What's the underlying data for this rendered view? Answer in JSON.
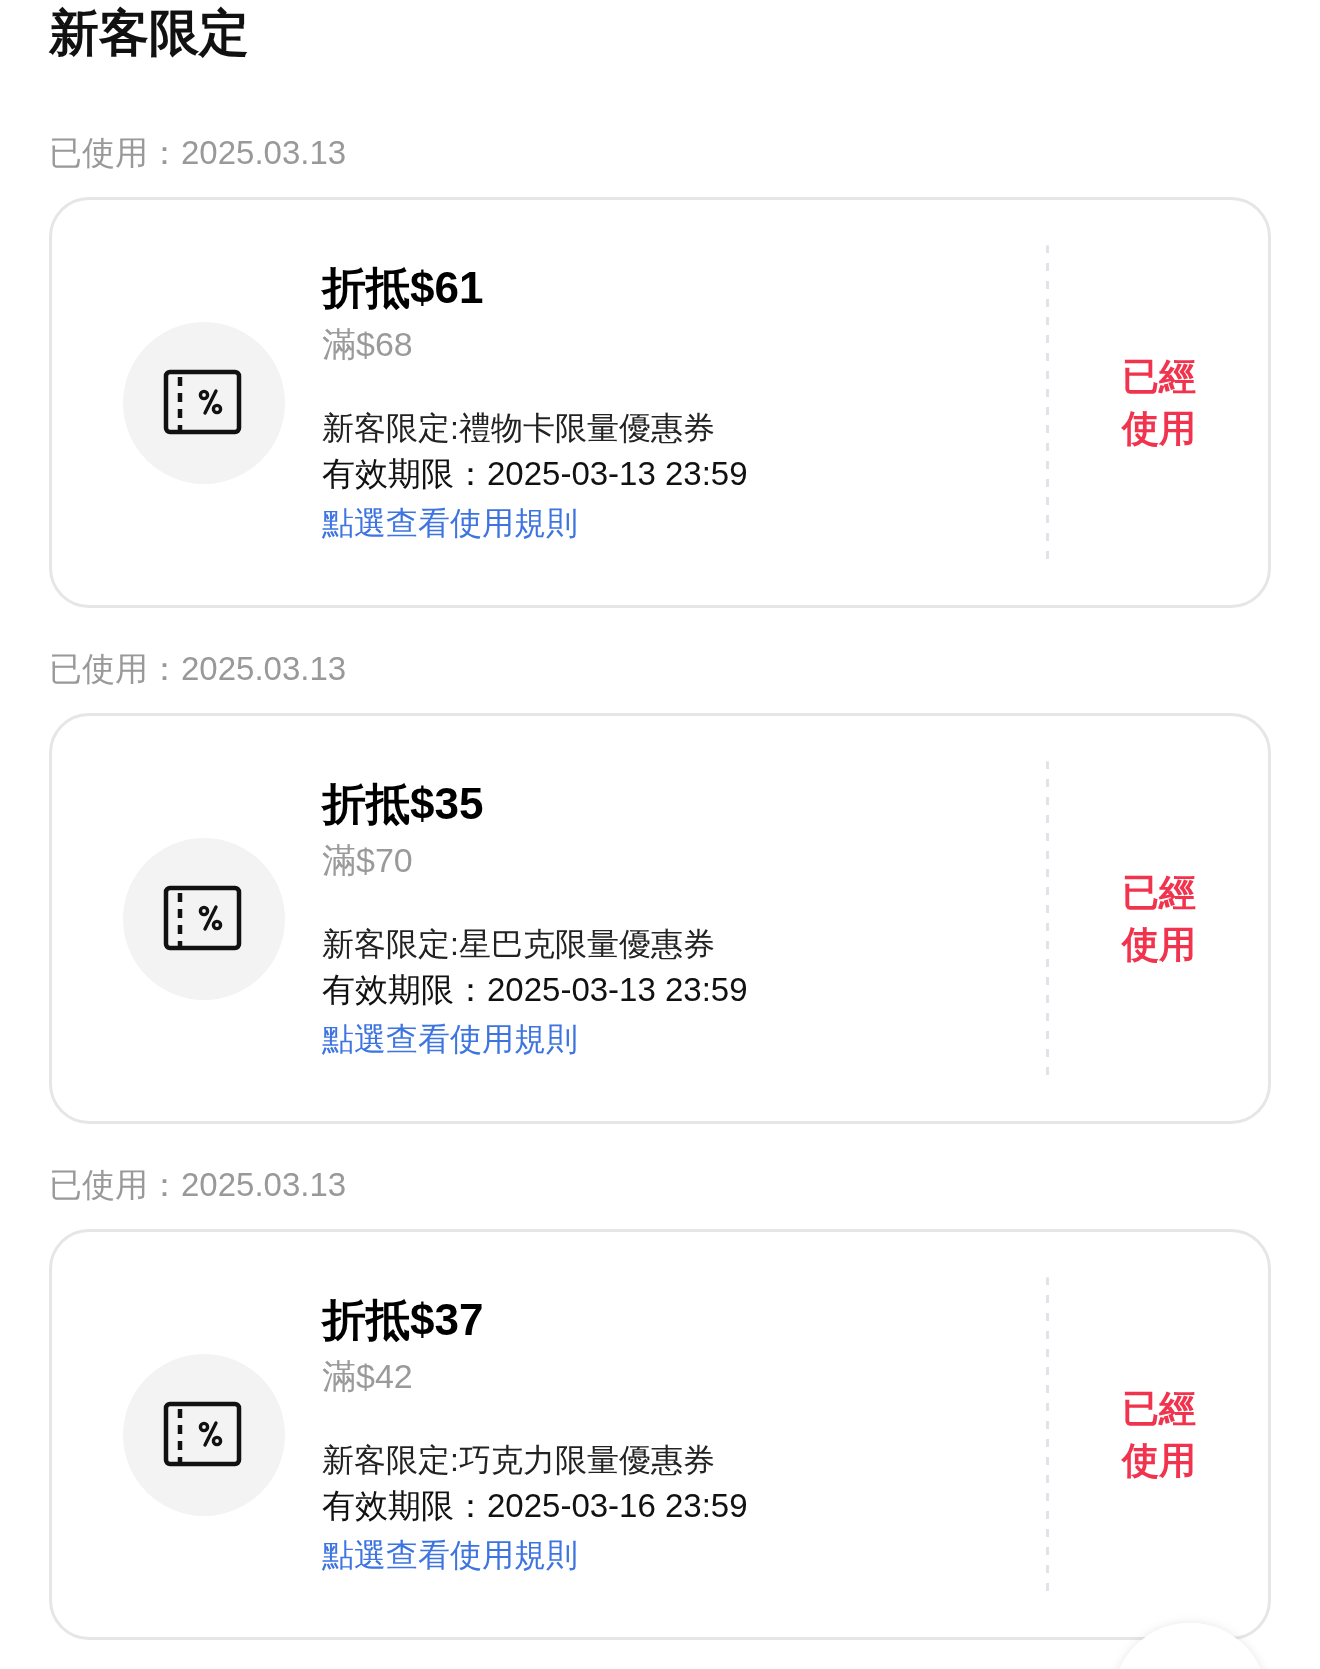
{
  "title": "新客限定",
  "coupons": [
    {
      "used_date": "已使用：2025.03.13",
      "discount": "折抵$61",
      "minimum": "滿$68",
      "name": "新客限定:禮物卡限量優惠券",
      "validity": "有效期限：2025-03-13 23:59",
      "rules_link": "點選查看使用規則",
      "status": "已經使用"
    },
    {
      "used_date": "已使用：2025.03.13",
      "discount": "折抵$35",
      "minimum": "滿$70",
      "name": "新客限定:星巴克限量優惠券",
      "validity": "有效期限：2025-03-13 23:59",
      "rules_link": "點選查看使用規則",
      "status": "已經使用"
    },
    {
      "used_date": "已使用：2025.03.13",
      "discount": "折抵$37",
      "minimum": "滿$42",
      "name": "新客限定:巧克力限量優惠券",
      "validity": "有效期限：2025-03-16 23:59",
      "rules_link": "點選查看使用規則",
      "status": "已經使用"
    }
  ]
}
